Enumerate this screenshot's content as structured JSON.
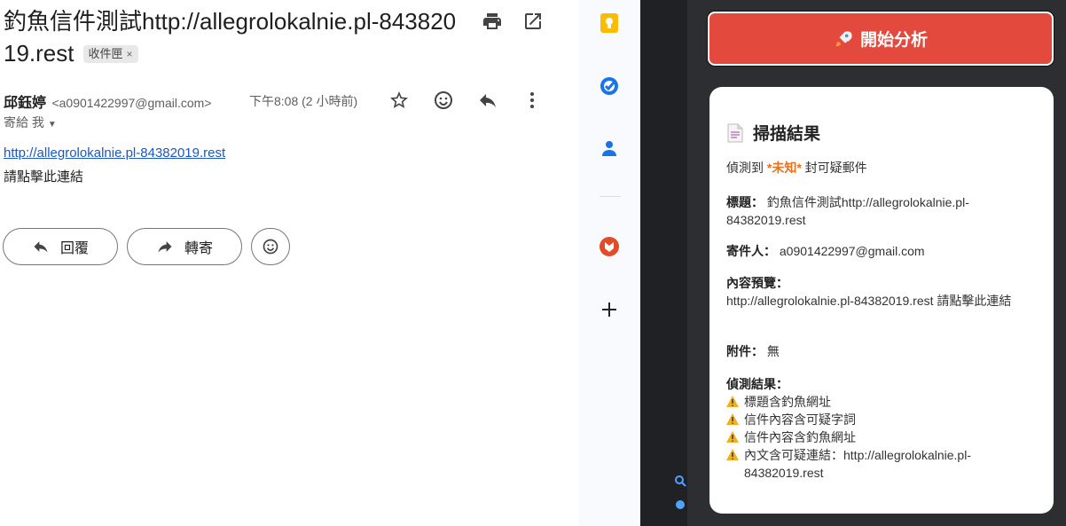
{
  "email": {
    "subject": "釣魚信件測試http://allegrolokalnie.pl-84382019.rest",
    "label": "收件匣",
    "label_close": "×",
    "sender_name": "邱鈺婷",
    "sender_email": "<a0901422997@gmail.com>",
    "time": "下午8:08 (2 小時前)",
    "to_me": "寄給 我",
    "body_link": "http://allegrolokalnie.pl-84382019.rest",
    "body_text": "請點擊此連結",
    "reply_label": "回覆",
    "forward_label": "轉寄"
  },
  "side_icons": [
    "keep-icon",
    "tasks-icon",
    "contacts-icon",
    "addon-icon",
    "add-icon"
  ],
  "panel": {
    "start_button": "開始分析",
    "result_title": "掃描結果",
    "detect_prefix": "偵測到 ",
    "detect_value": "*未知*",
    "detect_suffix": " 封可疑郵件",
    "subject_key": "標題：",
    "subject_val": "釣魚信件測試http://allegrolokalnie.pl-84382019.rest",
    "sender_key": "寄件人：",
    "sender_val": "a0901422997@gmail.com",
    "preview_key": "內容預覽：",
    "preview_val": "http://allegrolokalnie.pl-84382019.rest 請點擊此連結",
    "attach_key": "附件：",
    "attach_val": "無",
    "results_key": "偵測結果：",
    "warnings": [
      "標題含釣魚網址",
      "信件內容含可疑字詞",
      "信件內容含釣魚網址",
      "內文含可疑連結：http://allegrolokalnie.pl-84382019.rest"
    ]
  },
  "colors": {
    "start_button_bg": "#e4493d",
    "unknown_text": "#e8711c",
    "link": "#1a57c7",
    "dark_bg": "#202124"
  }
}
